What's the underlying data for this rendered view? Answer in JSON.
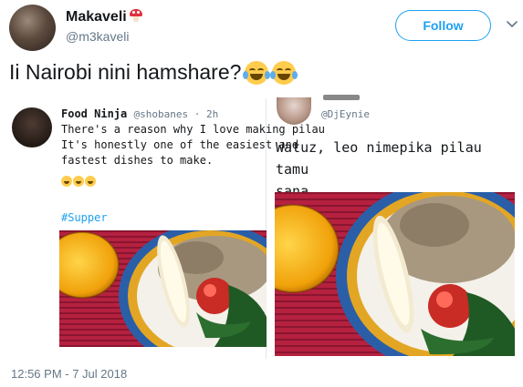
{
  "header": {
    "display_name": "Makaveli",
    "handle": "@m3kaveli",
    "follow_label": "Follow"
  },
  "tweet": {
    "text": "Ii Nairobi nini hamshare?",
    "emoji": "face-with-tears-of-joy x2",
    "timestamp": "12:56 PM - 7 Jul 2018"
  },
  "embedded": {
    "left_post": {
      "name": "Food Ninja",
      "handle": "@shobanes",
      "age": "2h",
      "lines": [
        "There's a reason why I love making pilau",
        "It's honestly one of the easiest and",
        "fastest dishes to make."
      ],
      "emoji": "smiling-face x3",
      "hashtag": "#Supper"
    },
    "right_post": {
      "handle": "@DjEynie",
      "lines": [
        "Watuz, leo nimepika pilau tamu",
        "sana"
      ]
    }
  },
  "colors": {
    "accent": "#1da1f2",
    "text": "#14171a",
    "muted": "#657786"
  },
  "icons": {
    "dropdown": "chevron-down-icon",
    "name_emoji": "mushroom-icon"
  }
}
